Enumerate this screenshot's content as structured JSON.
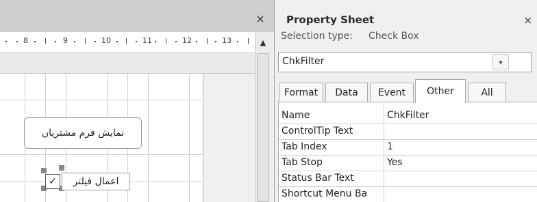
{
  "design_view": {
    "close_glyph": "×",
    "ruler_ticks": [
      "8",
      "9",
      "10",
      "11",
      "12",
      "13"
    ],
    "controls": {
      "command_button_label": "نمایش فرم مشتریان",
      "checkbox_label": "اعمال فیلتر",
      "checkbox_checked": true,
      "checkbox_glyph": "✓"
    },
    "scroll_up_glyph": "▲"
  },
  "property_sheet": {
    "title": "Property Sheet",
    "close_glyph": "×",
    "selection_type_label": "Selection type:",
    "selection_type_value": "Check Box",
    "object_combo_value": "ChkFilter",
    "combo_arrow_glyph": "▾",
    "tabs": [
      "Format",
      "Data",
      "Event",
      "Other",
      "All"
    ],
    "active_tab": "Other",
    "rows": [
      {
        "name": "Name",
        "value": "ChkFilter"
      },
      {
        "name": "ControlTip Text",
        "value": ""
      },
      {
        "name": "Tab Index",
        "value": "1"
      },
      {
        "name": "Tab Stop",
        "value": "Yes"
      },
      {
        "name": "Status Bar Text",
        "value": ""
      },
      {
        "name": "Shortcut Menu Ba",
        "value": ""
      }
    ]
  }
}
